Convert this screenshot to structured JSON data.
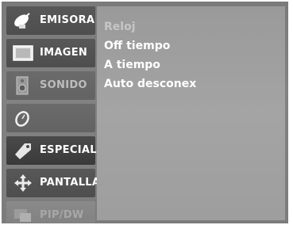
{
  "menu": {
    "items": [
      {
        "label": "EMISORA",
        "icon": "satellite-dish-icon",
        "state": "normal"
      },
      {
        "label": "IMAGEN",
        "icon": "picture-frame-icon",
        "state": "normal"
      },
      {
        "label": "SONIDO",
        "icon": "speaker-icon",
        "state": "dim"
      },
      {
        "label": "",
        "icon": "clock-icon",
        "state": "dim"
      },
      {
        "label": "ESPECIAL",
        "icon": "tag-icon",
        "state": "active"
      },
      {
        "label": "PANTALLA",
        "icon": "move-arrows-icon",
        "state": "normal"
      },
      {
        "label": "PIP/DW",
        "icon": "pip-screens-icon",
        "state": "dim2"
      }
    ]
  },
  "submenu": {
    "options": [
      {
        "label": "Reloj",
        "state": "faded"
      },
      {
        "label": "Off tiempo",
        "state": "normal"
      },
      {
        "label": "A tiempo",
        "state": "normal"
      },
      {
        "label": "Auto desconex",
        "state": "normal"
      }
    ]
  },
  "colors": {
    "background": "#7d7d7d",
    "panel": "#a0a0a0",
    "active_item": "#404040",
    "text": "#ffffff"
  }
}
